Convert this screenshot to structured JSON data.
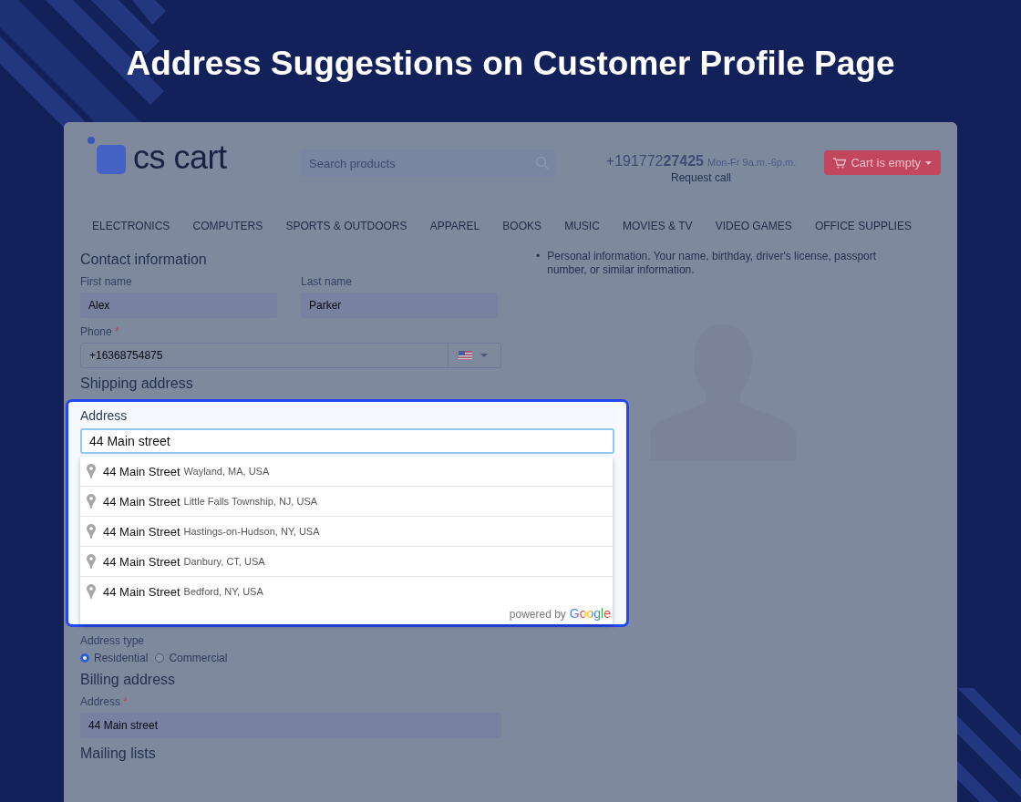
{
  "banner": {
    "title": "Address Suggestions on Customer Profile Page"
  },
  "header": {
    "logo_text": "cs cart",
    "search": {
      "placeholder": "Search products"
    },
    "phone": "+191772**27425**",
    "hours": "Mon-Fr 9a.m.-6p.m.",
    "request_call": "Request call",
    "cart": "Cart is empty"
  },
  "nav": [
    "ELECTRONICS",
    "COMPUTERS",
    "SPORTS & OUTDOORS",
    "APPAREL",
    "BOOKS",
    "MUSIC",
    "MOVIES & TV",
    "VIDEO GAMES",
    "OFFICE SUPPLIES"
  ],
  "contact": {
    "title": "Contact information",
    "fields": [
      {
        "label": "First name",
        "value": "Alex"
      },
      {
        "label": "Last name",
        "value": "Parker"
      }
    ],
    "phone": {
      "label": "Phone",
      "required_mark": "*",
      "value": "+16368754875"
    }
  },
  "shipping": {
    "title": "Shipping address",
    "address": {
      "label": "Address",
      "value": "44 Main street",
      "focused": true
    },
    "suggestions": [
      {
        "main": "44 Main Street",
        "secondary": "Wayland, MA, USA"
      },
      {
        "main": "44 Main Street",
        "secondary": "Little Falls Township, NJ, USA"
      },
      {
        "main": "44 Main Street",
        "secondary": "Hastings-on-Hudson, NY, USA"
      },
      {
        "main": "44 Main Street",
        "secondary": "Danbury, CT, USA"
      },
      {
        "main": "44 Main Street",
        "secondary": "Bedford, NY, USA"
      }
    ],
    "powered_by": "powered by",
    "brand": "Google",
    "address_type": {
      "label": "Address type",
      "options": [
        {
          "label": "Residential",
          "selected": true
        },
        {
          "label": "Commercial",
          "selected": false
        }
      ]
    }
  },
  "billing": {
    "title": "Billing address",
    "address": {
      "label": "Address",
      "required_mark": "*",
      "value": "44 Main street"
    }
  },
  "mailing": {
    "title": "Mailing lists"
  },
  "info": {
    "bullets": [
      {
        "marker": "•",
        "text": "Personal information. Your name, birthday, driver's license, passport number, or similar information."
      }
    ]
  }
}
